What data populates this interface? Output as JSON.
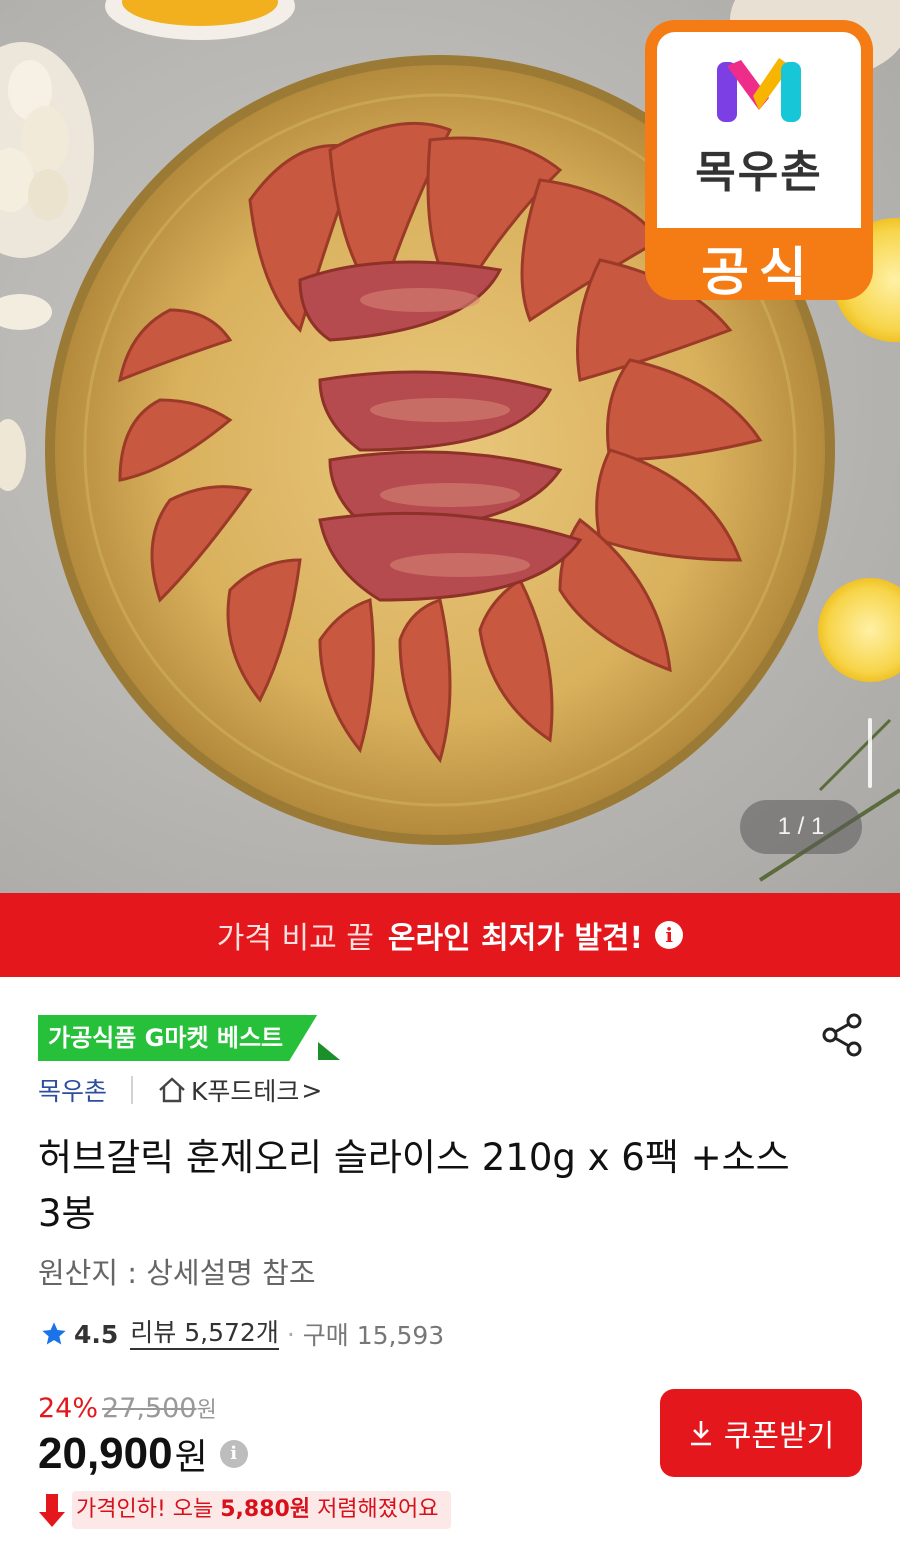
{
  "hero": {
    "brand_badge_name": "목우촌",
    "brand_badge_official": "공식",
    "image_counter": "1 / 1"
  },
  "promo_banner": {
    "prefix": "가격 비교 끝",
    "highlight": "온라인 최저가 발견!",
    "info_icon": "i"
  },
  "product": {
    "best_badge": "가공식품 G마켓 베스트",
    "brand": "목우촌",
    "store": "K푸드테크",
    "store_chevron": ">",
    "title": "허브갈릭 훈제오리 슬라이스 210g x 6팩 +소스 3봉",
    "origin": "원산지 : 상세설명 참조",
    "rating": "4.5",
    "reviews": "리뷰 5,572개",
    "separator": "·",
    "purchases": "구매 15,593",
    "discount_percent": "24%",
    "original_price": "27,500",
    "original_price_unit": "원",
    "price": "20,900",
    "price_unit": "원",
    "price_info_icon": "i",
    "coupon_button": "쿠폰받기",
    "price_drop_prefix": "가격인하! 오늘 ",
    "price_drop_amount": "5,880원",
    "price_drop_suffix": " 저렴해졌어요"
  },
  "colors": {
    "accent_red": "#e4181c",
    "badge_green": "#27c03a",
    "brand_orange": "#f57c14",
    "link_blue": "#2d4e9c",
    "star_blue": "#1a73e8"
  },
  "icons": [
    "share-icon",
    "home-icon",
    "star-icon",
    "download-icon",
    "info-icon",
    "down-arrow-icon"
  ]
}
